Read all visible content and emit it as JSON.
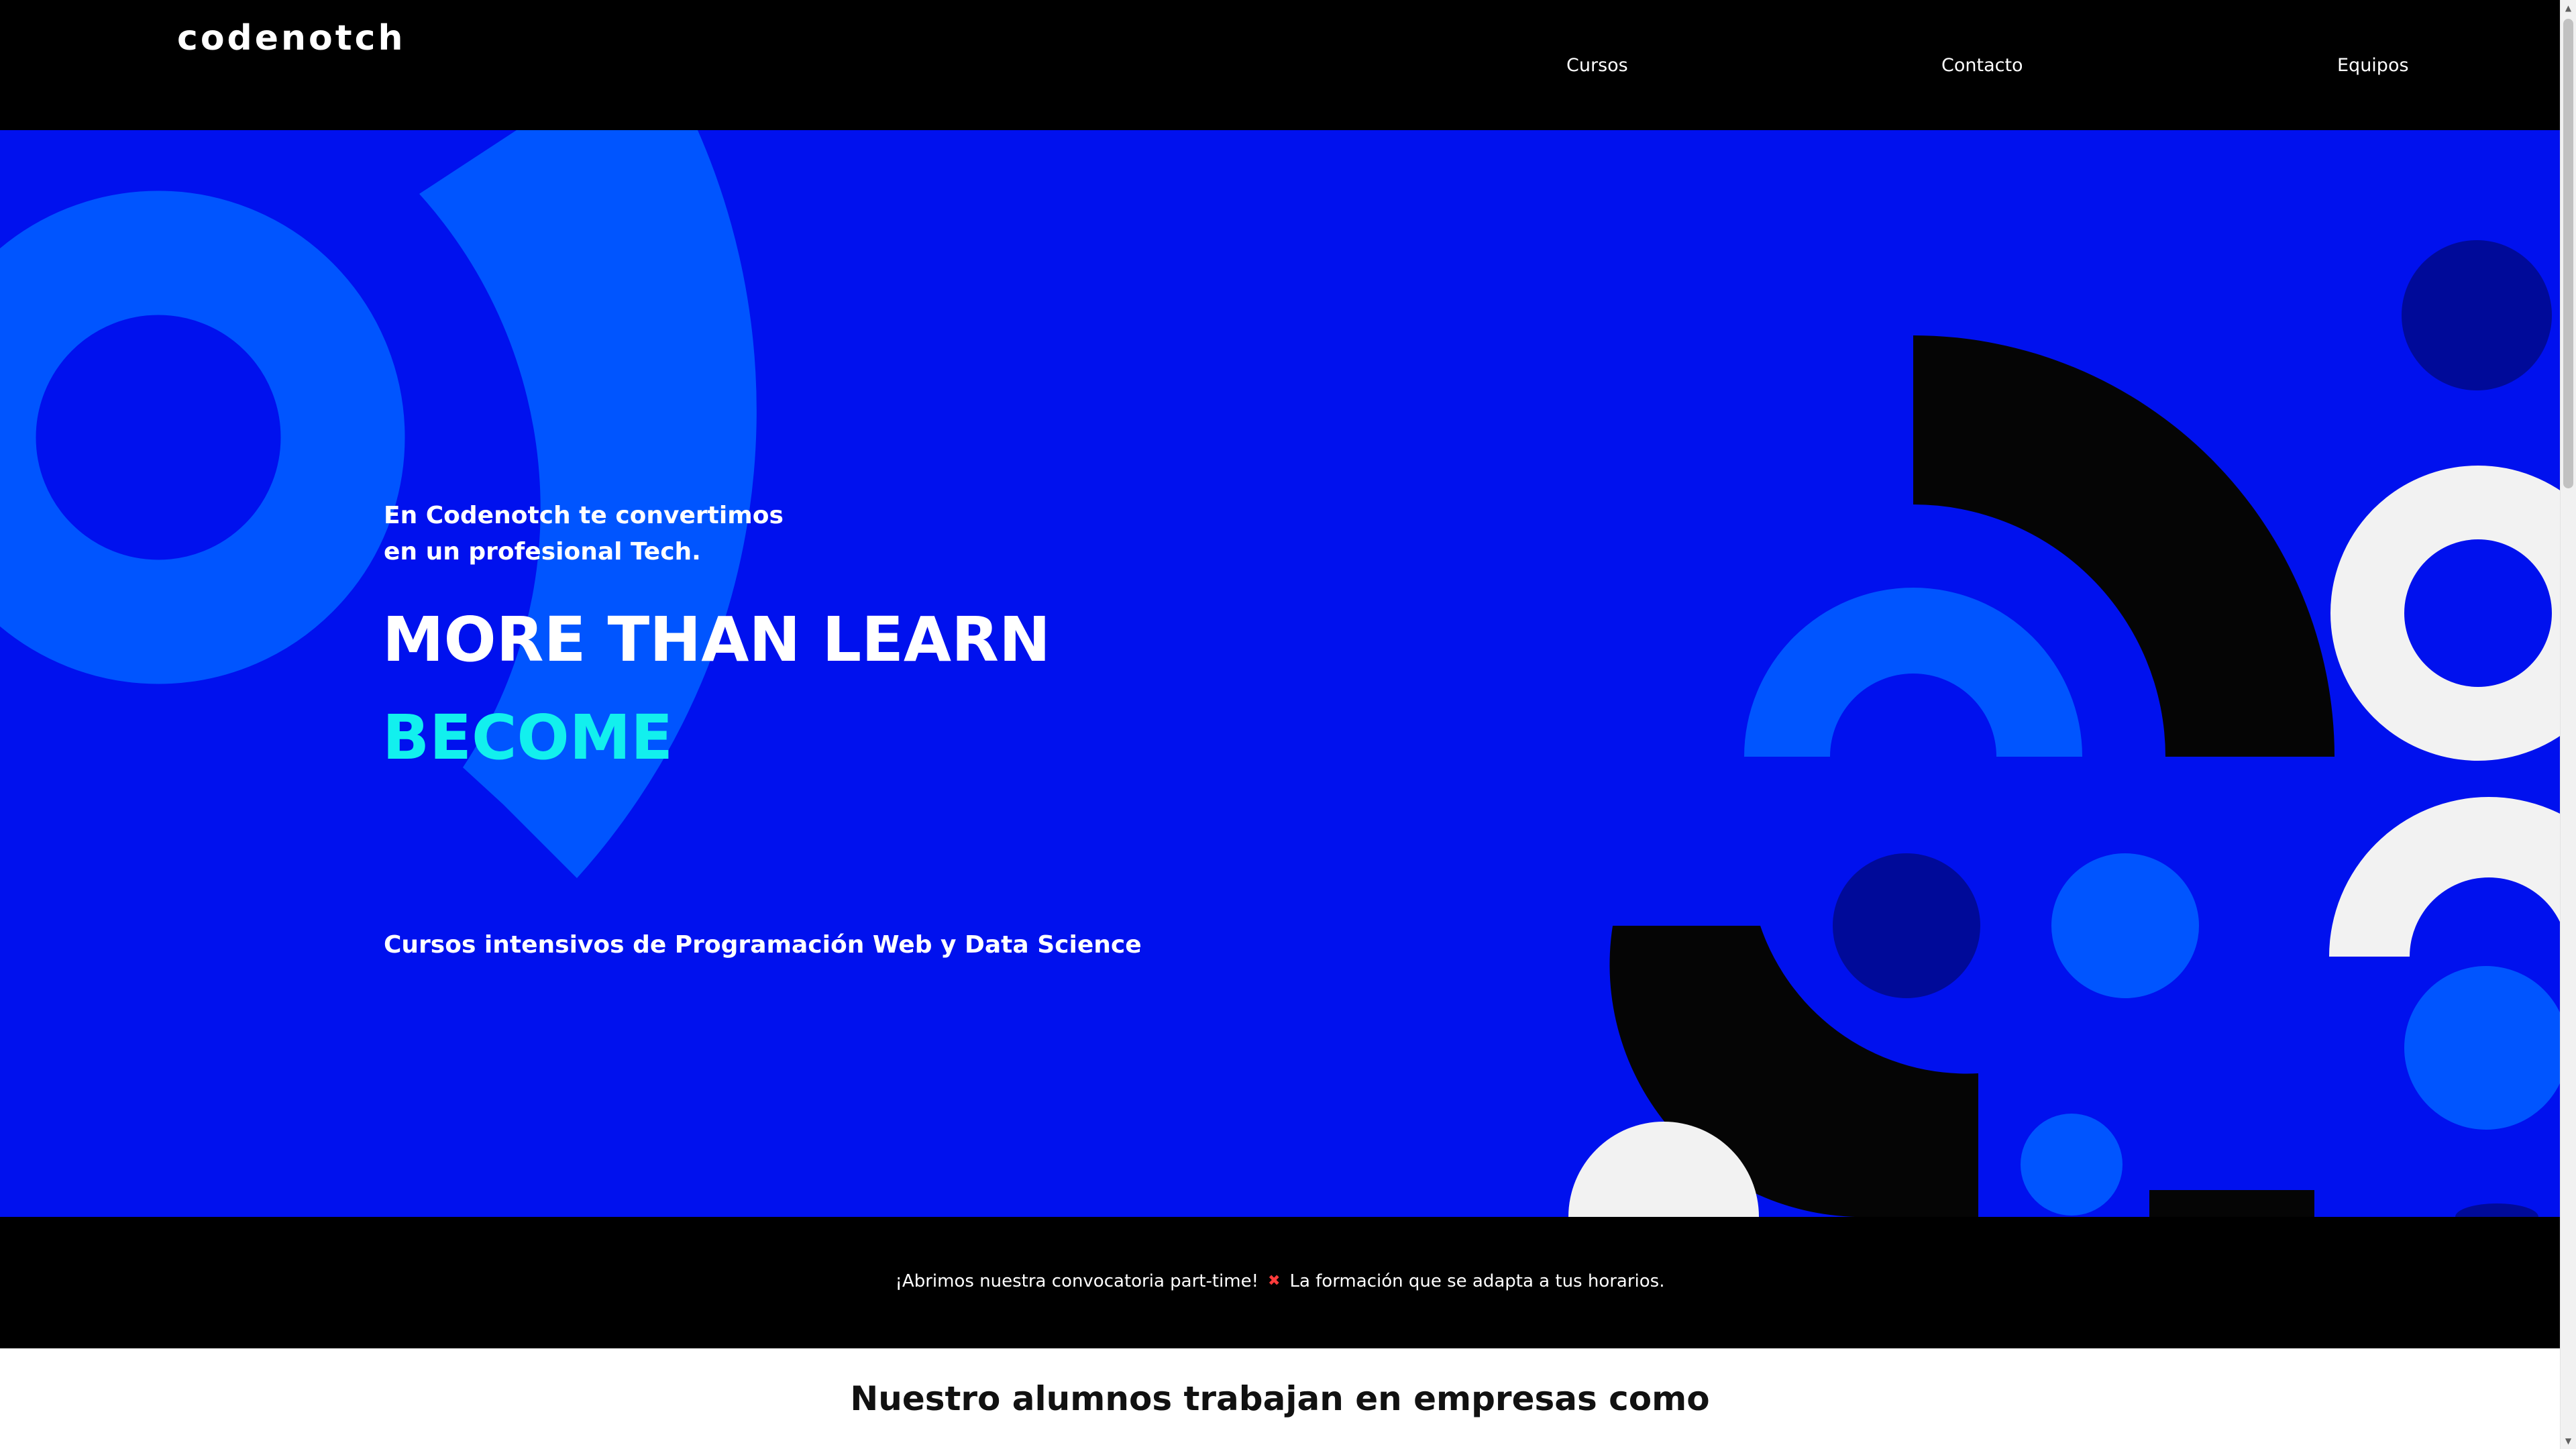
{
  "header": {
    "logo": "codenotch",
    "nav": [
      {
        "label": "Cursos"
      },
      {
        "label": "Contacto"
      },
      {
        "label": "Equipos"
      }
    ]
  },
  "hero": {
    "intro_line1": "En Codenotch te convertimos",
    "intro_line2": "en un profesional Tech.",
    "title": "MORE THAN LEARN",
    "highlight": "BECOME",
    "subtitle": "Cursos intensivos de Programación Web y Data Science"
  },
  "announcement": {
    "text_before": "¡Abrimos nuestra convocatoria part-time!",
    "icon": "cross-mark-icon",
    "text_after": "La formación que se adapta a tus horarios."
  },
  "companies": {
    "title": "Nuestro alumnos trabajan en empresas como"
  },
  "colors": {
    "hero_bg": "#0011ee",
    "accent_cyan": "#12f0ee",
    "light_blue": "#0055ff",
    "dark_blue": "#000a99",
    "black": "#000000"
  }
}
